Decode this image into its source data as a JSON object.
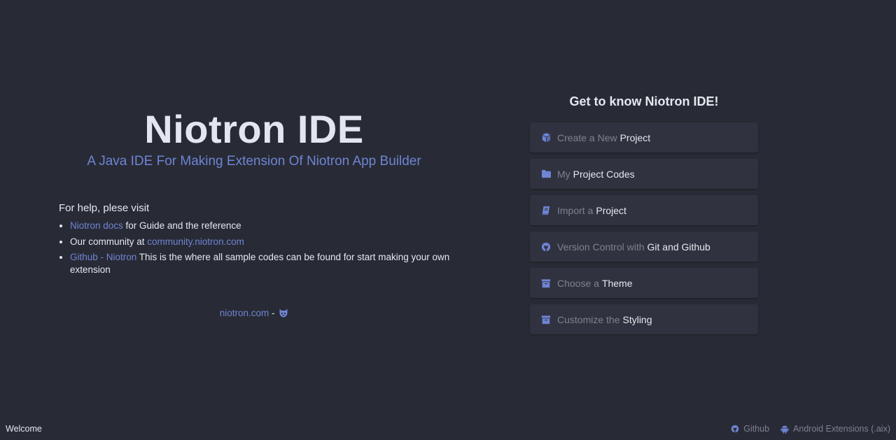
{
  "hero": {
    "title": "Niotron IDE",
    "subtitle": "A Java IDE For Making Extension Of Niotron App Builder"
  },
  "help": {
    "heading": "For help, plese visit",
    "items": [
      {
        "link": "Niotron docs",
        "text": " for Guide and the reference"
      },
      {
        "prefix": "Our community at ",
        "link": "community.niotron.com"
      },
      {
        "link": "Github - Niotron",
        "text": " This is the where all sample codes can be found for start making your own extension"
      }
    ]
  },
  "footer": {
    "site_link": "niotron.com",
    "separator": " - ",
    "github_icon": "github-octocat-icon"
  },
  "cards": {
    "title": "Get to know Niotron IDE!",
    "items": [
      {
        "icon": "cube-icon",
        "muted": "Create a New",
        "strong": "Project"
      },
      {
        "icon": "folder-icon",
        "muted": "My",
        "strong": "Project Codes"
      },
      {
        "icon": "book-icon",
        "muted": "Import a",
        "strong": "Project"
      },
      {
        "icon": "github-icon",
        "muted": "Version Control with",
        "strong": "Git and Github"
      },
      {
        "icon": "archive-icon",
        "muted": "Choose a",
        "strong": "Theme"
      },
      {
        "icon": "archive-icon",
        "muted": "Customize the",
        "strong": "Styling"
      }
    ]
  },
  "statusbar": {
    "left": "Welcome",
    "github": "Github",
    "android": "Android Extensions (.aix)"
  },
  "colors": {
    "background": "#282b35",
    "card": "#30333f",
    "accent": "#6f84d4",
    "muted": "#7d8291",
    "text": "#e6e8ef"
  }
}
